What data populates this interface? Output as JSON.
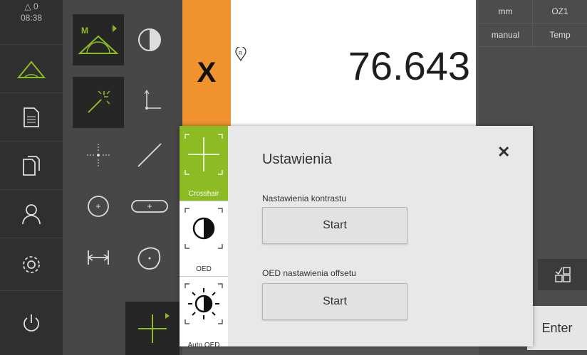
{
  "status": {
    "warnings": "0",
    "time": "08:38"
  },
  "axis": {
    "label": "X",
    "value": "76.643"
  },
  "right_panel": {
    "unit": "mm",
    "zone": "OZ1",
    "mode": "manual",
    "temp": "Temp"
  },
  "dialog": {
    "title": "Ustawienia",
    "contrast_label": "Nastawienia kontrastu",
    "contrast_button": "Start",
    "offset_label": "OED nastawienia offsetu",
    "offset_button": "Start"
  },
  "dialog_tabs": [
    {
      "label": "Crosshair"
    },
    {
      "label": "OED"
    },
    {
      "label": "Auto OED"
    }
  ],
  "enter_label": "Enter",
  "colors": {
    "accent_green": "#8cbb23",
    "axis_orange": "#f0922e",
    "nav_bg": "#2f2f2f"
  }
}
